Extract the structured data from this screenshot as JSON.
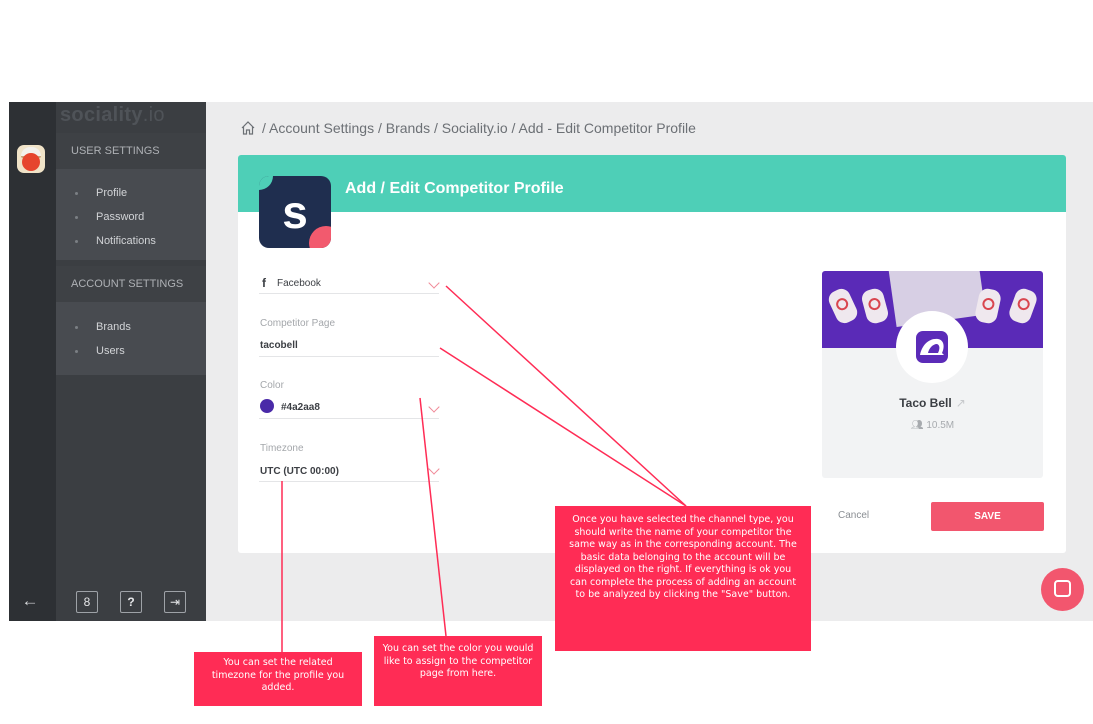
{
  "app": {
    "logo": {
      "word": "sociality",
      "suffix": ".io"
    },
    "user_settings_heading": "USER SETTINGS",
    "user_items": [
      "Profile",
      "Password",
      "Notifications"
    ],
    "account_settings_heading": "ACCOUNT SETTINGS",
    "account_items": [
      "Brands",
      "Users"
    ],
    "footer_buttons": {
      "back": "←",
      "user": "8",
      "help": "?",
      "logout": "⇥"
    }
  },
  "breadcrumb": "/ Account Settings / Brands / Sociality.io / Add - Edit Competitor Profile",
  "card": {
    "title": "Add / Edit Competitor Profile",
    "brand_letter": "s",
    "channel": {
      "value": "Facebook",
      "icon": "facebook-icon"
    },
    "competitor_page": {
      "label": "Competitor Page",
      "value": "tacobell"
    },
    "color": {
      "label": "Color",
      "value": "#4a2aa8",
      "swatch": "#4a2aa8"
    },
    "timezone": {
      "label": "Timezone",
      "value": "UTC (UTC 00:00)"
    }
  },
  "preview": {
    "name": "Taco Bell",
    "followers": "10.5M"
  },
  "actions": {
    "cancel": "Cancel",
    "save": "SAVE"
  },
  "colors": {
    "accent_teal": "#4ecfb7",
    "accent_pink": "#f2566e",
    "tooltip": "#ff2c55",
    "sidebar_dark": "#2d3034"
  },
  "tooltips": {
    "competitor": "Once you have selected the channel type, you should write the name of your competitor the same way as in the corresponding account. The basic data belonging to the account will be displayed on the right. If everything is ok you can complete the process of adding an account to be analyzed by clicking the \"Save\" button.",
    "color": "You can set the color you would like to assign to the competitor page from here.",
    "timezone": "You can set the related timezone for the profile you added."
  }
}
